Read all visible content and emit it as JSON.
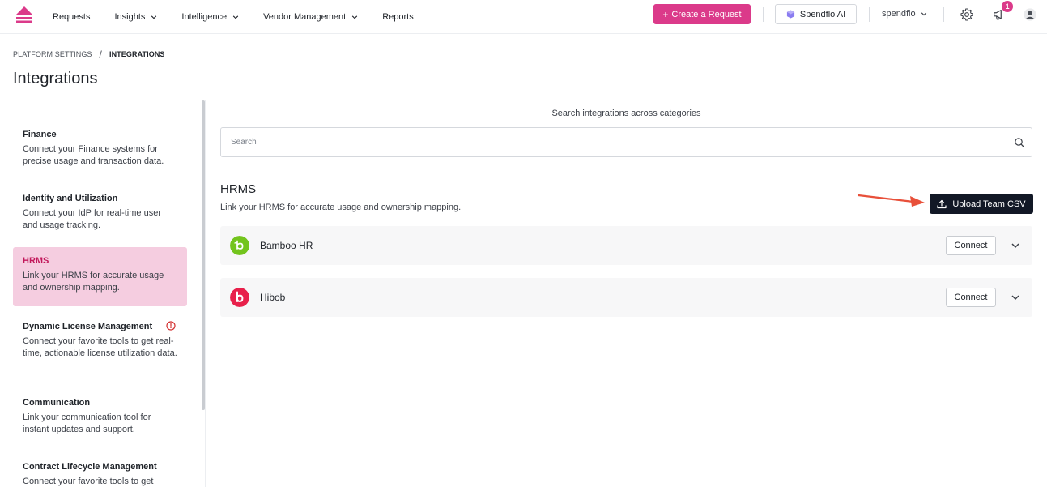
{
  "nav": {
    "items": [
      {
        "label": "Requests",
        "dropdown": false
      },
      {
        "label": "Insights",
        "dropdown": true
      },
      {
        "label": "Intelligence",
        "dropdown": true
      },
      {
        "label": "Vendor Management",
        "dropdown": true
      },
      {
        "label": "Reports",
        "dropdown": false
      }
    ],
    "create_label": "Create a Request",
    "ai_label": "Spendflo AI",
    "account_label": "spendflo",
    "notification_count": "1",
    "icons": [
      "logo-icon",
      "gear-icon",
      "megaphone-icon",
      "user-icon"
    ]
  },
  "breadcrumb": {
    "parent": "PLATFORM SETTINGS",
    "separator": "/",
    "current": "INTEGRATIONS"
  },
  "page": {
    "title": "Integrations"
  },
  "sidebar": {
    "categories": [
      {
        "name": "Finance",
        "desc": "Connect your Finance systems for precise usage and transaction data."
      },
      {
        "name": "Identity and Utilization",
        "desc": "Connect your IdP for real-time user and usage tracking."
      },
      {
        "name": "HRMS",
        "desc": "Link your HRMS for accurate usage and ownership mapping.",
        "active": true
      },
      {
        "name": "Dynamic License Management",
        "desc": "Connect your favorite tools to get real-time, actionable license utilization data.",
        "warning": true
      },
      {
        "name": "Communication",
        "desc": "Link your communication tool for instant updates and support."
      },
      {
        "name": "Contract Lifecycle Management",
        "desc": "Connect your favorite tools to get"
      }
    ]
  },
  "search": {
    "label": "Search integrations across categories",
    "placeholder": "Search",
    "value": ""
  },
  "section": {
    "title": "HRMS",
    "desc": "Link your HRMS for accurate usage and ownership mapping.",
    "upload_label": "Upload Team CSV",
    "integrations": [
      {
        "name": "Bamboo HR",
        "connect_label": "Connect",
        "color": "#73c41d",
        "icon": "bamboo-hr-logo-icon"
      },
      {
        "name": "Hibob",
        "connect_label": "Connect",
        "color": "#e8204b",
        "icon": "hibob-logo-icon"
      }
    ]
  },
  "colors": {
    "brand": "#db3a8a",
    "active_bg": "#f5cde0",
    "dark_button": "#121826",
    "annotation_arrow": "#e8503a"
  }
}
